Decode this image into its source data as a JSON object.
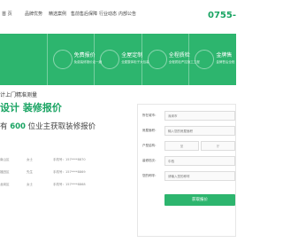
{
  "nav": {
    "items": [
      "首 页",
      "品牌优势",
      "精选案例",
      "售前售后保障",
      "行业动态",
      "内部公告"
    ],
    "phone": "0755-"
  },
  "banner": {
    "features": [
      {
        "title": "",
        "subtitle": ""
      },
      {
        "title": "免费报价",
        "subtitle": "免费装修报价走一趟"
      },
      {
        "title": "全屋定制",
        "subtitle": "全屋整体柜子大包装"
      },
      {
        "title": "全程质检",
        "subtitle": "全程质检严控施工工程"
      },
      {
        "title": "金牌售",
        "subtitle": "金牌售后全程"
      }
    ]
  },
  "promo": {
    "tagline": "计上门精准测量",
    "headline": "设计    装修报价",
    "count_prefix": "有",
    "count": "600",
    "count_suffix": "位业主获取装修报价"
  },
  "records": [
    {
      "name": "女士",
      "district": "南山区",
      "mobile": "手机号：157****8870"
    },
    {
      "name": "先生",
      "district": "福田区",
      "mobile": "手机号：157****8869"
    },
    {
      "name": "女士",
      "district": "龙岗区",
      "mobile": "手机号：157****8868"
    }
  ],
  "form": {
    "fields": [
      {
        "label": "所在城市：",
        "placeholder": "深圳市"
      },
      {
        "label": "房屋面积：",
        "placeholder": "输入您的房屋面积"
      },
      {
        "label": "户型结构：",
        "left": "室",
        "right": "厅"
      },
      {
        "label": "装修档次：",
        "placeholder": "中档"
      },
      {
        "label": "您的称呼：",
        "placeholder": "请输入您的称呼"
      }
    ],
    "submit_label": "获取报价"
  }
}
